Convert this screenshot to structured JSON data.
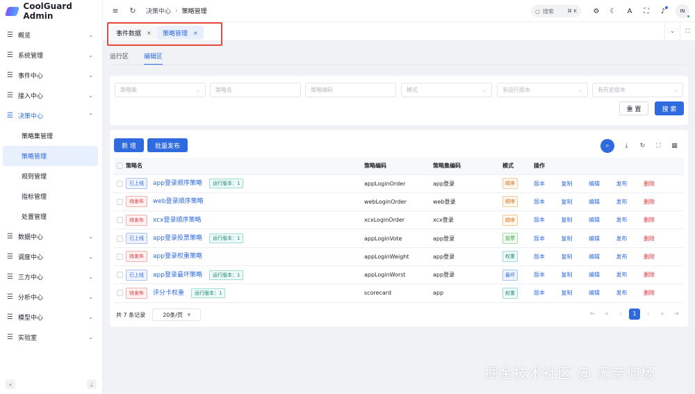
{
  "app": {
    "title": "CoolGuard Admin"
  },
  "header": {
    "breadcrumb": [
      "决策中心",
      "策略管理"
    ],
    "search_label": "搜索",
    "search_shortcut": "⌘ K",
    "avatar_text": "IN"
  },
  "tabs": [
    {
      "label": "事件数据",
      "close": "×"
    },
    {
      "label": "策略管理",
      "close": "×"
    }
  ],
  "sidebar": {
    "items": [
      {
        "label": "概览"
      },
      {
        "label": "系统管理"
      },
      {
        "label": "事件中心"
      },
      {
        "label": "接入中心"
      },
      {
        "label": "决策中心"
      },
      {
        "label": "数据中心"
      },
      {
        "label": "调度中心"
      },
      {
        "label": "三方中心"
      },
      {
        "label": "分析中心"
      },
      {
        "label": "模型中心"
      },
      {
        "label": "实验室"
      }
    ],
    "subitems": [
      {
        "label": "策略集管理"
      },
      {
        "label": "策略管理"
      },
      {
        "label": "规则管理"
      },
      {
        "label": "指标管理"
      },
      {
        "label": "处置管理"
      }
    ]
  },
  "subtabs": [
    "运行区",
    "编辑区"
  ],
  "filters": {
    "placeholders": [
      "策略集",
      "策略名",
      "策略编码",
      "模式",
      "有运行版本",
      "有历史版本"
    ],
    "reset": "重 置",
    "search": "搜 索"
  },
  "toolbar": {
    "add": "新 增",
    "batch_publish": "批量发布"
  },
  "table": {
    "columns": [
      "策略名",
      "策略编码",
      "策略集编码",
      "模式",
      "操作"
    ],
    "actions": [
      "版本",
      "复制",
      "编辑",
      "发布",
      "删除"
    ],
    "rows": [
      {
        "status": "已上线",
        "status_type": "online",
        "name": "app登录顺序策略",
        "version": "运行版本：1",
        "code": "appLoginOrder",
        "set_code": "app登录",
        "mode": "顺序",
        "mode_color": "orange"
      },
      {
        "status": "待发布",
        "status_type": "pending",
        "name": "web登录顺序策略",
        "version": "",
        "code": "webLoginOrder",
        "set_code": "web登录",
        "mode": "顺序",
        "mode_color": "orange"
      },
      {
        "status": "待发布",
        "status_type": "pending",
        "name": "xcx登录顺序策略",
        "version": "",
        "code": "xcxLoginOrder",
        "set_code": "xcx登录",
        "mode": "顺序",
        "mode_color": "orange"
      },
      {
        "status": "已上线",
        "status_type": "online",
        "name": "app登录投票策略",
        "version": "运行版本：1",
        "code": "appLoginVote",
        "set_code": "app登录",
        "mode": "投票",
        "mode_color": "green"
      },
      {
        "status": "待发布",
        "status_type": "pending",
        "name": "app登录权重策略",
        "version": "",
        "code": "appLoginWeight",
        "set_code": "app登录",
        "mode": "权重",
        "mode_color": "teal"
      },
      {
        "status": "已上线",
        "status_type": "online",
        "name": "app登录最坏策略",
        "version": "运行版本：1",
        "code": "appLoginWorst",
        "set_code": "app登录",
        "mode": "最坏",
        "mode_color": "blue"
      },
      {
        "status": "待发布",
        "status_type": "pending",
        "name": "评分卡权重",
        "version": "运行版本：1",
        "code": "scorecard",
        "set_code": "app",
        "mode": "权重",
        "mode_color": "teal"
      }
    ]
  },
  "pagination": {
    "total": "共 7 条记录",
    "page_size": "20条/页",
    "current": "1"
  },
  "watermark": "掘金技术社区 @ 无奈何杨"
}
